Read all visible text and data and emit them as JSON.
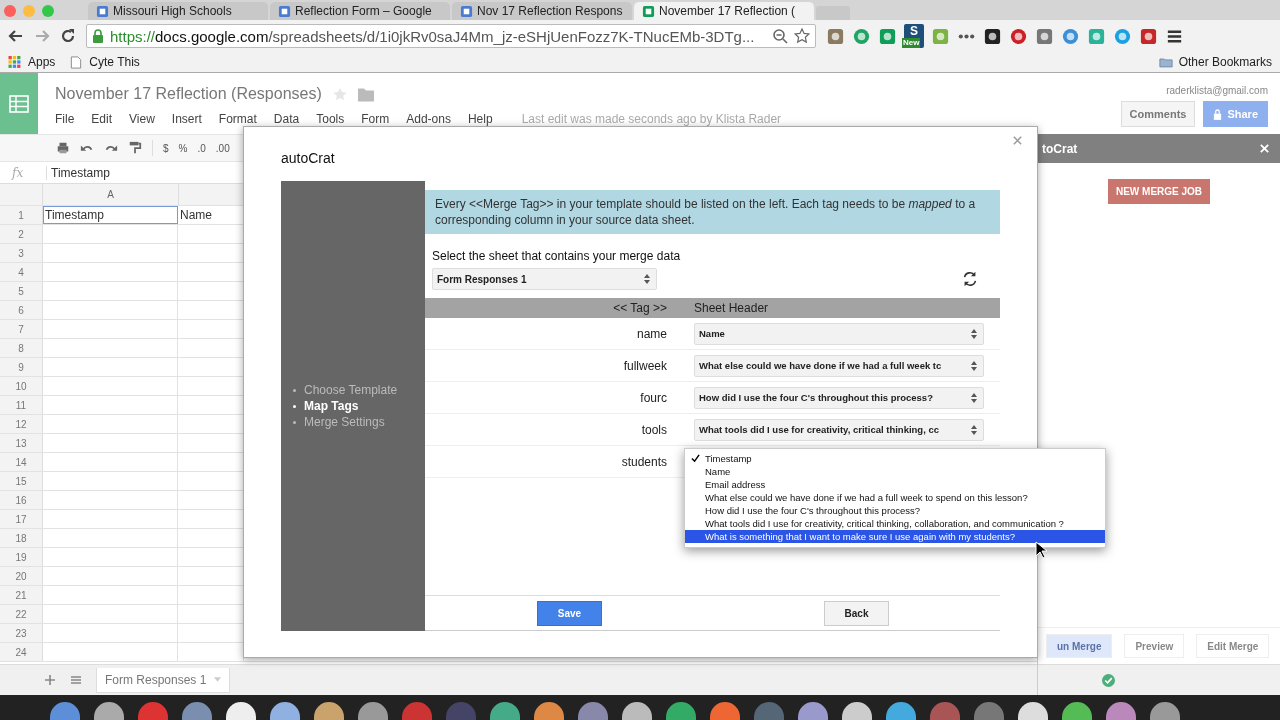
{
  "browser": {
    "tabs": [
      {
        "label": "Missouri High Schools",
        "selected": false
      },
      {
        "label": "Reflection Form – Google",
        "selected": false
      },
      {
        "label": "Nov 17 Reflection Respons",
        "selected": false
      },
      {
        "label": "November 17 Reflection (",
        "selected": true
      }
    ],
    "url_scheme": "https://",
    "url_host": "docs.google.com",
    "url_path": "/spreadsheets/d/1i0jkRv0saJ4Mm_jz-eSHjUenFozz7K-TNucEMb-3DTg...",
    "extension_letter": "S",
    "extension_badge": "New",
    "bookmarks": [
      "Apps",
      "Cyte This"
    ],
    "other_bookmarks": "Other Bookmarks"
  },
  "document": {
    "title": "November 17 Reflection (Responses)",
    "menu": [
      "File",
      "Edit",
      "View",
      "Insert",
      "Format",
      "Data",
      "Tools",
      "Form",
      "Add-ons",
      "Help"
    ],
    "last_edit": "Last edit was made seconds ago by Klista Rader",
    "account": "raderklista@gmail.com",
    "comments": "Comments",
    "share": "Share"
  },
  "toolbar": {
    "format_buttons": [
      "$",
      "%",
      ".0",
      ".00"
    ]
  },
  "formula_bar": {
    "fx": "fx",
    "value": "Timestamp"
  },
  "grid": {
    "columns": [
      "A"
    ],
    "rows": [
      {
        "number": "1",
        "cells": [
          {
            "text": "Timestamp",
            "selected": true
          },
          {
            "text": "Name",
            "selected": false
          }
        ]
      },
      {
        "number": "2"
      },
      {
        "number": "3"
      },
      {
        "number": "4"
      },
      {
        "number": "5"
      },
      {
        "number": "6"
      },
      {
        "number": "7"
      },
      {
        "number": "8"
      },
      {
        "number": "9"
      },
      {
        "number": "10"
      },
      {
        "number": "11"
      },
      {
        "number": "12"
      },
      {
        "number": "13"
      },
      {
        "number": "14"
      },
      {
        "number": "15"
      },
      {
        "number": "16"
      },
      {
        "number": "17"
      },
      {
        "number": "18"
      },
      {
        "number": "19"
      },
      {
        "number": "20"
      },
      {
        "number": "21"
      },
      {
        "number": "22"
      },
      {
        "number": "23"
      },
      {
        "number": "24"
      }
    ]
  },
  "sheet_tabs": [
    {
      "label": "Form Responses 1",
      "selected": true
    }
  ],
  "sidebar": {
    "title": "toCrat",
    "new_job": "NEW MERGE JOB",
    "actions": [
      "un Merge",
      "Preview",
      "Edit Merge"
    ]
  },
  "dialog": {
    "title": "autoCrat",
    "steps": [
      {
        "label": "Choose Template",
        "selected": false
      },
      {
        "label": "Map Tags",
        "selected": true
      },
      {
        "label": "Merge Settings",
        "selected": false
      }
    ],
    "info": "Every <<Merge Tag>> in your template should be listed on the left. Each tag needs to be *mapped* to a corresponding column in your source data sheet.",
    "sheet_label": "Select the sheet that contains your merge data",
    "sheet_select": "Form Responses 1",
    "table_headers": [
      "<< Tag >>",
      "Sheet Header"
    ],
    "mappings": [
      {
        "tag": "name",
        "value": "Name"
      },
      {
        "tag": "fullweek",
        "value": "What else could we have done if we had a full week tc"
      },
      {
        "tag": "fourc",
        "value": "How did I use the four C's throughout this process?"
      },
      {
        "tag": "tools",
        "value": "What tools did I use for creativity, critical thinking, cc"
      },
      {
        "tag": "students"
      }
    ],
    "save": "Save",
    "back": "Back",
    "dropdown": [
      {
        "label": "Timestamp",
        "checked": true,
        "highlighted": false
      },
      {
        "label": "Name",
        "checked": false,
        "highlighted": false
      },
      {
        "label": "Email address",
        "checked": false,
        "highlighted": false
      },
      {
        "label": "What else could we have done if we had a full week to spend on this lesson?",
        "checked": false,
        "highlighted": false
      },
      {
        "label": "How did I use the four C's throughout this process?",
        "checked": false,
        "highlighted": false
      },
      {
        "label": "What tools did I use for creativity, critical thinking, collaboration, and communication ?",
        "checked": false,
        "highlighted": false
      },
      {
        "label": "What is something that I want to make sure I use again with my students?",
        "checked": false,
        "highlighted": true
      }
    ]
  }
}
